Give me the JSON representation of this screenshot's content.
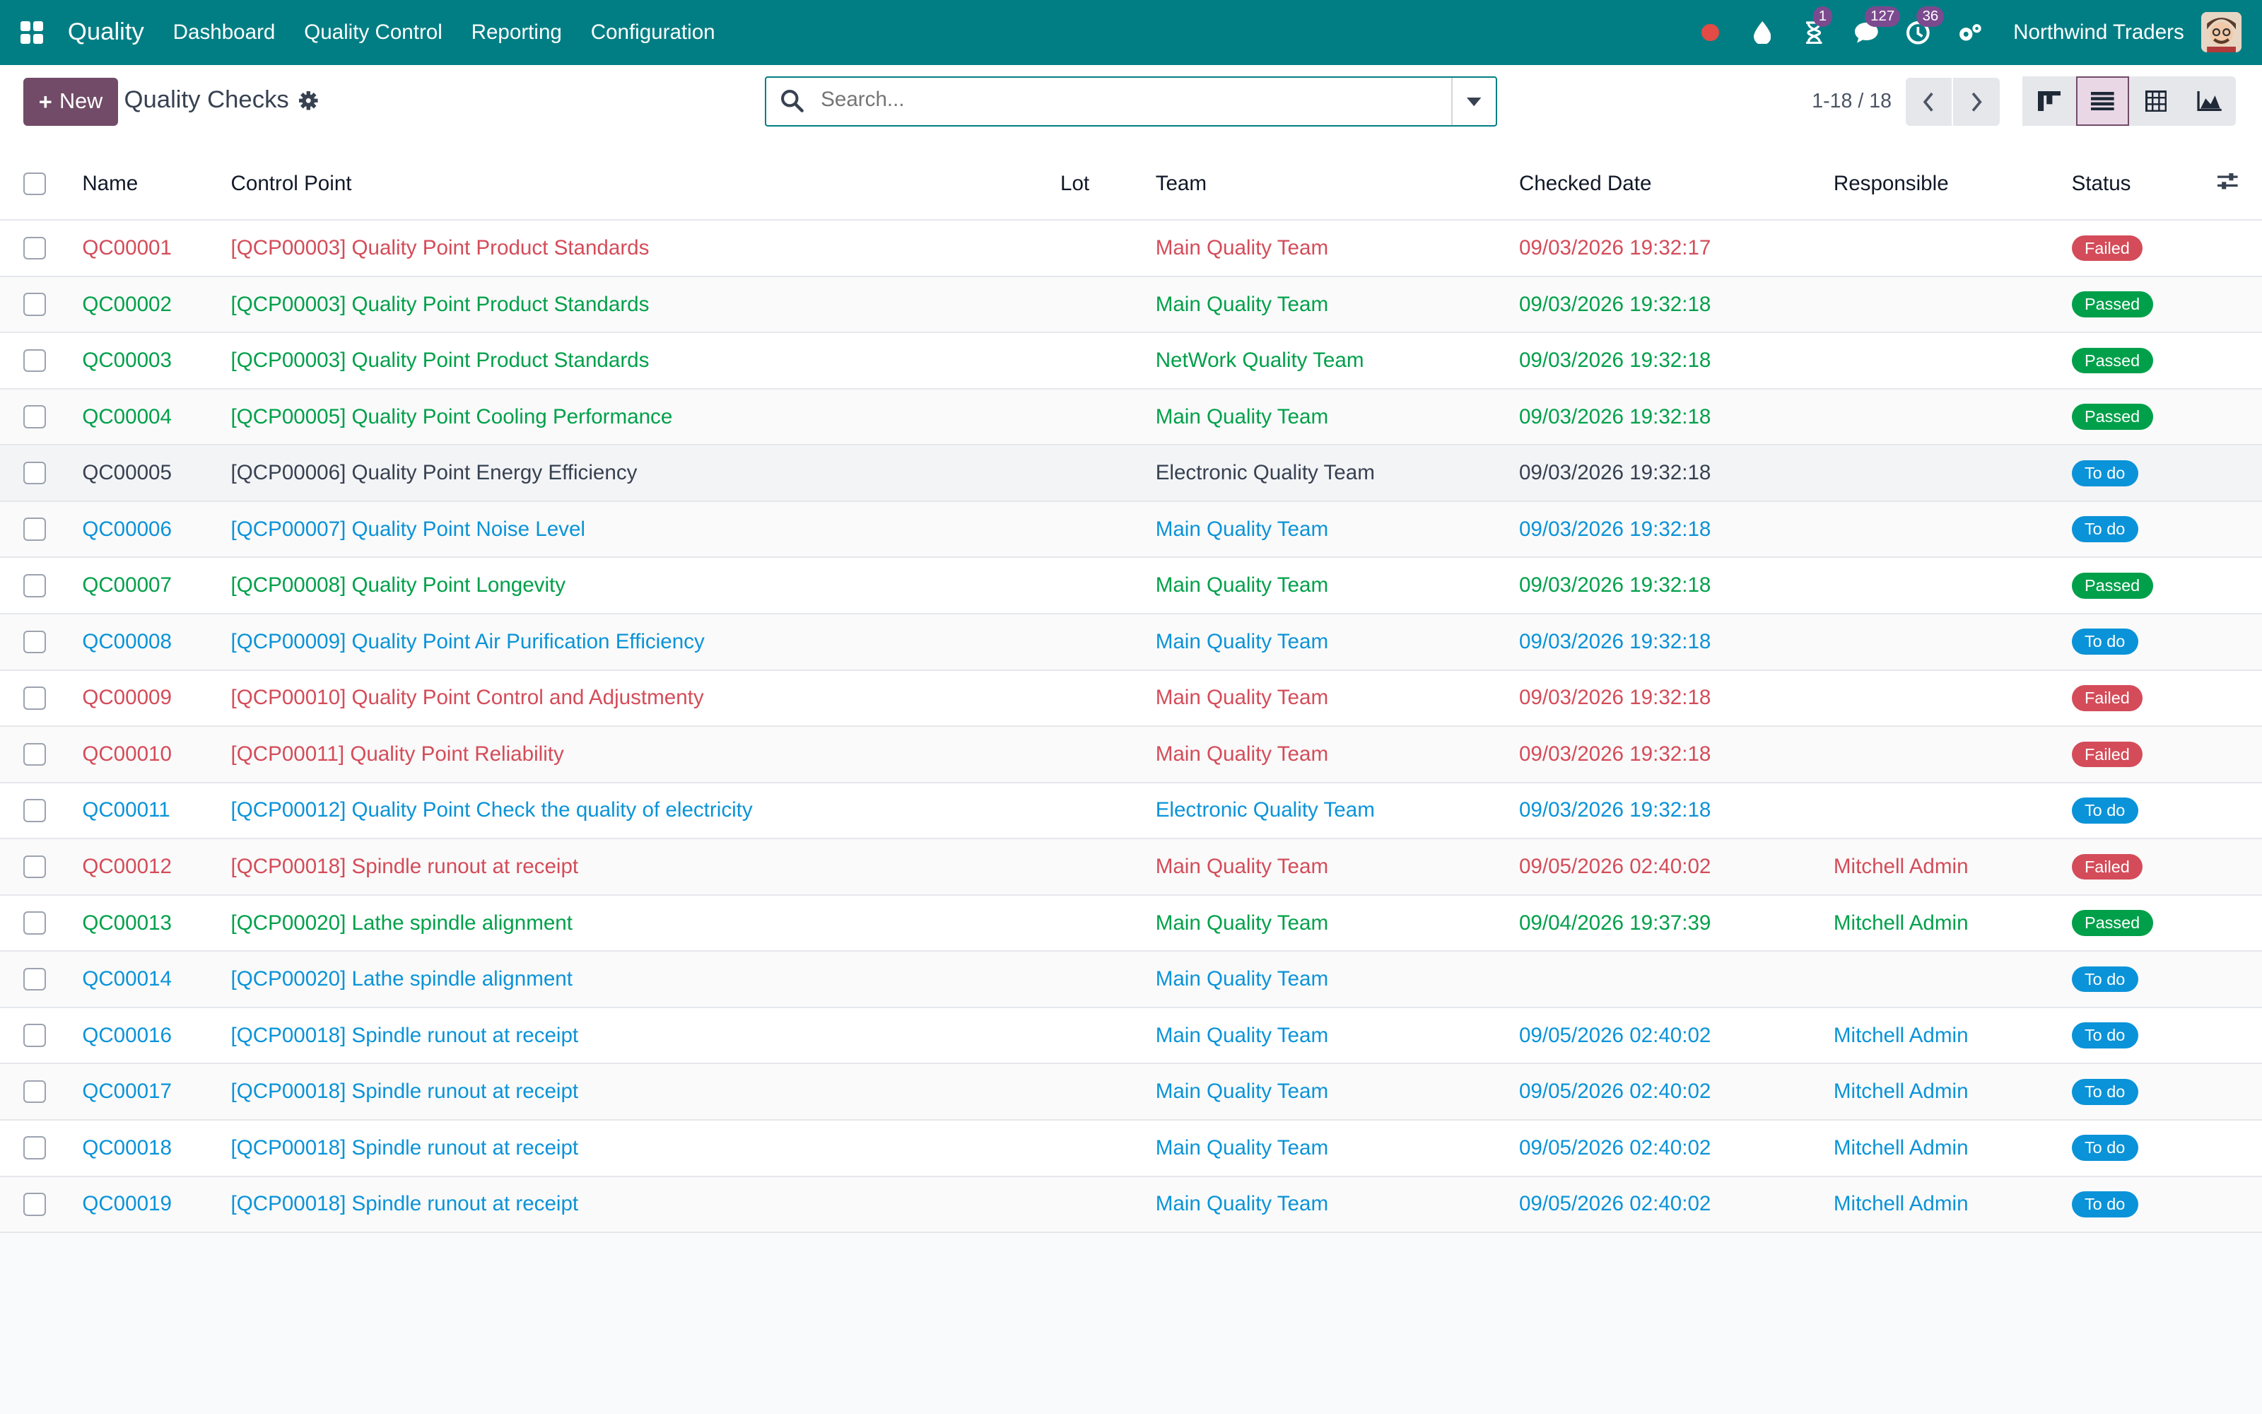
{
  "navbar": {
    "app_name": "Quality",
    "menu": [
      "Dashboard",
      "Quality Control",
      "Reporting",
      "Configuration"
    ],
    "badges": {
      "activities_timer": "1",
      "messages": "127",
      "activities": "36"
    },
    "company": "Northwind Traders",
    "icons": [
      "apps-icon",
      "record-icon",
      "drop-icon",
      "hourglass-icon",
      "chat-icon",
      "clock-icon",
      "settings-icon"
    ]
  },
  "control_panel": {
    "new_label": "New",
    "title": "Quality Checks",
    "search_placeholder": "Search...",
    "pager": "1-18 / 18",
    "views": [
      "kanban",
      "list",
      "pivot",
      "graph"
    ],
    "active_view": "list"
  },
  "list": {
    "columns": {
      "name": "Name",
      "control_point": "Control Point",
      "lot": "Lot",
      "team": "Team",
      "checked_date": "Checked Date",
      "responsible": "Responsible",
      "status": "Status"
    },
    "rows": [
      {
        "name": "QC00001",
        "control_point": "[QCP00003] Quality Point Product Standards",
        "lot": "",
        "team": "Main Quality Team",
        "checked_date": "09/03/2026 19:32:17",
        "responsible": "",
        "status": "Failed"
      },
      {
        "name": "QC00002",
        "control_point": "[QCP00003] Quality Point Product Standards",
        "lot": "",
        "team": "Main Quality Team",
        "checked_date": "09/03/2026 19:32:18",
        "responsible": "",
        "status": "Passed"
      },
      {
        "name": "QC00003",
        "control_point": "[QCP00003] Quality Point Product Standards",
        "lot": "",
        "team": "NetWork Quality Team",
        "checked_date": "09/03/2026 19:32:18",
        "responsible": "",
        "status": "Passed"
      },
      {
        "name": "QC00004",
        "control_point": "[QCP00005] Quality Point Cooling Performance",
        "lot": "",
        "team": "Main Quality Team",
        "checked_date": "09/03/2026 19:32:18",
        "responsible": "",
        "status": "Passed"
      },
      {
        "name": "QC00005",
        "control_point": "[QCP00006] Quality Point Energy Efficiency",
        "lot": "",
        "team": "Electronic Quality Team",
        "checked_date": "09/03/2026 19:32:18",
        "responsible": "",
        "status": "To do"
      },
      {
        "name": "QC00006",
        "control_point": "[QCP00007] Quality Point Noise Level",
        "lot": "",
        "team": "Main Quality Team",
        "checked_date": "09/03/2026 19:32:18",
        "responsible": "",
        "status": "To do"
      },
      {
        "name": "QC00007",
        "control_point": "[QCP00008] Quality Point Longevity",
        "lot": "",
        "team": "Main Quality Team",
        "checked_date": "09/03/2026 19:32:18",
        "responsible": "",
        "status": "Passed"
      },
      {
        "name": "QC00008",
        "control_point": "[QCP00009] Quality Point Air Purification Efficiency",
        "lot": "",
        "team": "Main Quality Team",
        "checked_date": "09/03/2026 19:32:18",
        "responsible": "",
        "status": "To do"
      },
      {
        "name": "QC00009",
        "control_point": "[QCP00010] Quality Point Control and Adjustmenty",
        "lot": "",
        "team": "Main Quality Team",
        "checked_date": "09/03/2026 19:32:18",
        "responsible": "",
        "status": "Failed"
      },
      {
        "name": "QC00010",
        "control_point": "[QCP00011] Quality Point Reliability",
        "lot": "",
        "team": "Main Quality Team",
        "checked_date": "09/03/2026 19:32:18",
        "responsible": "",
        "status": "Failed"
      },
      {
        "name": "QC00011",
        "control_point": "[QCP00012] Quality Point Check the quality of electricity",
        "lot": "",
        "team": "Electronic Quality Team",
        "checked_date": "09/03/2026 19:32:18",
        "responsible": "",
        "status": "To do"
      },
      {
        "name": "QC00012",
        "control_point": "[QCP00018] Spindle runout at receipt",
        "lot": "",
        "team": "Main Quality Team",
        "checked_date": "09/05/2026 02:40:02",
        "responsible": "Mitchell Admin",
        "status": "Failed"
      },
      {
        "name": "QC00013",
        "control_point": "[QCP00020] Lathe spindle alignment",
        "lot": "",
        "team": "Main Quality Team",
        "checked_date": "09/04/2026 19:37:39",
        "responsible": "Mitchell Admin",
        "status": "Passed"
      },
      {
        "name": "QC00014",
        "control_point": "[QCP00020] Lathe spindle alignment",
        "lot": "",
        "team": "Main Quality Team",
        "checked_date": "",
        "responsible": "",
        "status": "To do"
      },
      {
        "name": "QC00016",
        "control_point": "[QCP00018] Spindle runout at receipt",
        "lot": "",
        "team": "Main Quality Team",
        "checked_date": "09/05/2026 02:40:02",
        "responsible": "Mitchell Admin",
        "status": "To do"
      },
      {
        "name": "QC00017",
        "control_point": "[QCP00018] Spindle runout at receipt",
        "lot": "",
        "team": "Main Quality Team",
        "checked_date": "09/05/2026 02:40:02",
        "responsible": "Mitchell Admin",
        "status": "To do"
      },
      {
        "name": "QC00018",
        "control_point": "[QCP00018] Spindle runout at receipt",
        "lot": "",
        "team": "Main Quality Team",
        "checked_date": "09/05/2026 02:40:02",
        "responsible": "Mitchell Admin",
        "status": "To do"
      },
      {
        "name": "QC00019",
        "control_point": "[QCP00018] Spindle runout at receipt",
        "lot": "",
        "team": "Main Quality Team",
        "checked_date": "09/05/2026 02:40:02",
        "responsible": "Mitchell Admin",
        "status": "To do"
      }
    ]
  },
  "status_colors": {
    "Failed": {
      "text": "#d44c59",
      "pill": "#d44c59"
    },
    "Passed": {
      "text": "#00a04a",
      "pill": "#00a04a"
    },
    "To do": {
      "text": "#0a93d8",
      "pill": "#0a93d8"
    },
    "neutral": {
      "text": "#374151",
      "pill": "#0a93d8"
    }
  },
  "accent": {
    "navbar": "#017e84",
    "primary": "#714b67"
  }
}
